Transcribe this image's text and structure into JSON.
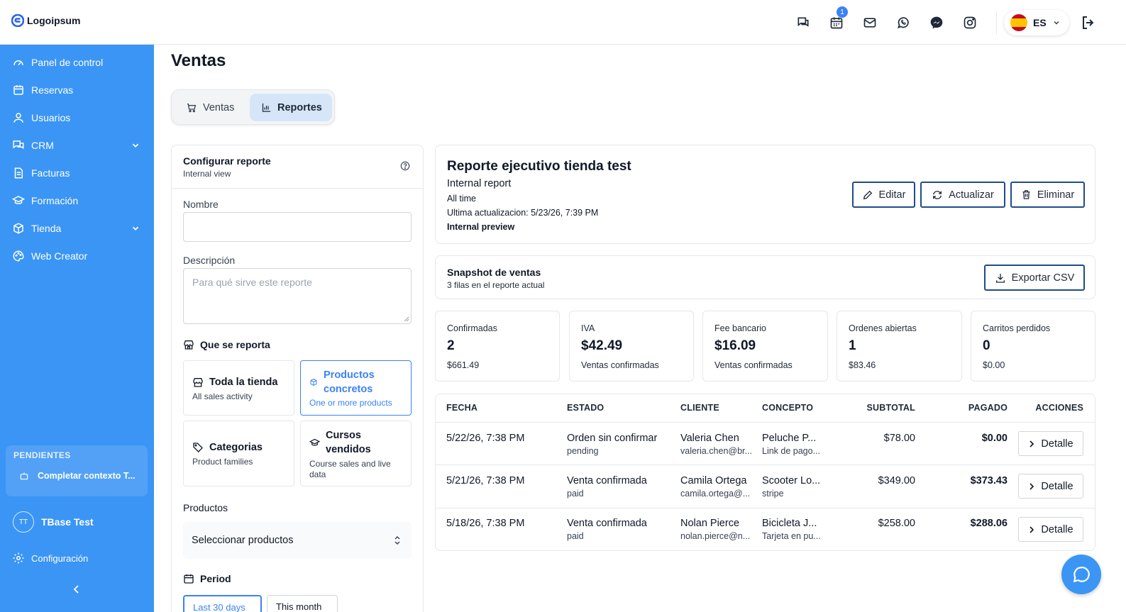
{
  "brand": {
    "name": "Logoipsum"
  },
  "header": {
    "notifications_count": "1",
    "language": "ES"
  },
  "sidebar": {
    "items": [
      {
        "label": "Panel de control"
      },
      {
        "label": "Reservas"
      },
      {
        "label": "Usuarios"
      },
      {
        "label": "CRM"
      },
      {
        "label": "Facturas"
      },
      {
        "label": "Formación"
      },
      {
        "label": "Tienda"
      },
      {
        "label": "Web Creator"
      }
    ],
    "pending_title": "PENDIENTES",
    "pending_item": "Completar contexto T...",
    "user_initials": "TT",
    "user_name": "TBase Test",
    "config_label": "Configuración"
  },
  "page": {
    "title": "Ventas",
    "tabs": [
      {
        "label": "Ventas"
      },
      {
        "label": "Reportes"
      }
    ]
  },
  "config": {
    "title": "Configurar reporte",
    "subtitle": "Internal view",
    "name_label": "Nombre",
    "name_value": "",
    "desc_label": "Descripción",
    "desc_placeholder": "Para qué sirve este reporte",
    "scope_label": "Que se reporta",
    "scope_options": [
      {
        "title": "Toda la tienda",
        "sub": "All sales activity"
      },
      {
        "title": "Productos concretos",
        "sub": "One or more products"
      },
      {
        "title": "Categorias",
        "sub": "Product families"
      },
      {
        "title": "Cursos vendidos",
        "sub": "Course sales and live data"
      }
    ],
    "products_label": "Productos",
    "products_placeholder": "Seleccionar productos",
    "period_label": "Period",
    "period_options": [
      {
        "label": "Last 30 days"
      },
      {
        "label": "This month"
      }
    ]
  },
  "report": {
    "title": "Reporte ejecutivo tienda test",
    "type": "Internal report",
    "range": "All time",
    "updated": "Ultima actualizacion: 5/23/26, 7:39 PM",
    "preview": "Internal preview",
    "edit_label": "Editar",
    "refresh_label": "Actualizar",
    "delete_label": "Eliminar"
  },
  "snapshot": {
    "title": "Snapshot de ventas",
    "subtitle": "3 filas en el reporte actual",
    "export_label": "Exportar CSV"
  },
  "stats": [
    {
      "label": "Confirmadas",
      "value": "2",
      "sub": "$661.49"
    },
    {
      "label": "IVA",
      "value": "$42.49",
      "sub": "Ventas confirmadas"
    },
    {
      "label": "Fee bancario",
      "value": "$16.09",
      "sub": "Ventas confirmadas"
    },
    {
      "label": "Ordenes abiertas",
      "value": "1",
      "sub": "$83.46"
    },
    {
      "label": "Carritos perdidos",
      "value": "0",
      "sub": "$0.00"
    }
  ],
  "table": {
    "headers": [
      "FECHA",
      "ESTADO",
      "CLIENTE",
      "CONCEPTO",
      "SUBTOTAL",
      "PAGADO",
      "ACCIONES"
    ],
    "action_label": "Detalle",
    "rows": [
      {
        "fecha": "5/22/26, 7:38 PM",
        "estado": "Orden sin confirmar",
        "estado_sub": "pending",
        "cliente": "Valeria Chen",
        "cliente_sub": "valeria.chen@br...",
        "concepto": "Peluche P...",
        "concepto_sub": "Link de pago...",
        "subtotal": "$78.00",
        "pagado": "$0.00"
      },
      {
        "fecha": "5/21/26, 7:38 PM",
        "estado": "Venta confirmada",
        "estado_sub": "paid",
        "cliente": "Camila Ortega",
        "cliente_sub": "camila.ortega@...",
        "concepto": "Scooter Lo...",
        "concepto_sub": "stripe",
        "subtotal": "$349.00",
        "pagado": "$373.43"
      },
      {
        "fecha": "5/18/26, 7:38 PM",
        "estado": "Venta confirmada",
        "estado_sub": "paid",
        "cliente": "Nolan Pierce",
        "cliente_sub": "nolan.pierce@n...",
        "concepto": "Bicicleta J...",
        "concepto_sub": "Tarjeta en pu...",
        "subtotal": "$258.00",
        "pagado": "$288.06"
      }
    ]
  }
}
